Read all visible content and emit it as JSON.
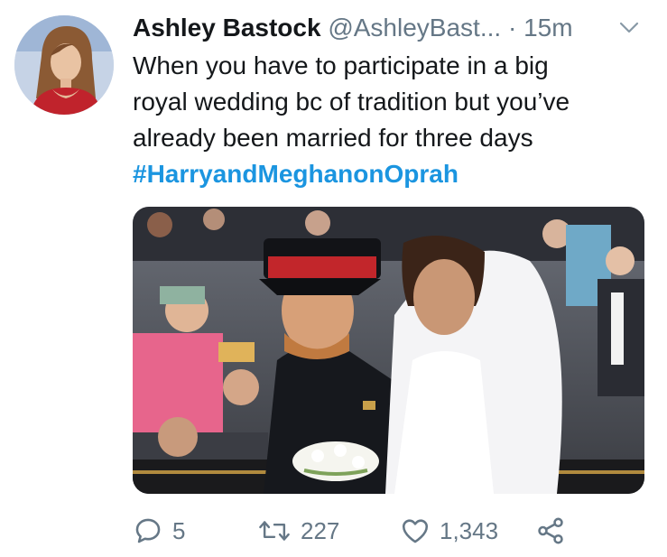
{
  "author": {
    "name": "Ashley Bastock",
    "handle": "@AshleyBast...",
    "separator": "·",
    "time": "15m"
  },
  "tweet": {
    "lines": [
      "When you have to participate in a big",
      "royal wedding bc of tradition but you’ve",
      "already been married for three days"
    ],
    "hashtag": "#HarryandMeghanonOprah"
  },
  "actions": {
    "replies": "5",
    "retweets": "227",
    "likes": "1,343"
  },
  "colors": {
    "text": "#14171a",
    "muted": "#657786",
    "link": "#1b95e0"
  },
  "icons": [
    "chevron-down-icon",
    "reply-icon",
    "retweet-icon",
    "like-icon",
    "share-icon"
  ]
}
